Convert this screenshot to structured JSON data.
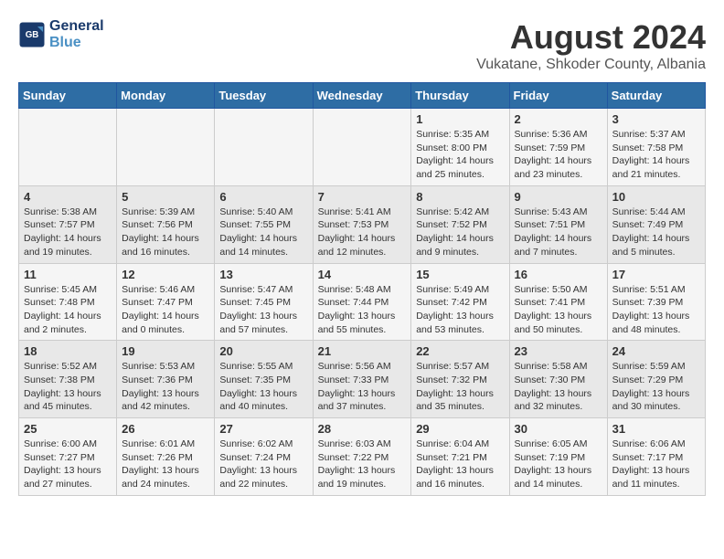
{
  "header": {
    "logo_line1": "General",
    "logo_line2": "Blue",
    "month_year": "August 2024",
    "location": "Vukatane, Shkoder County, Albania"
  },
  "weekdays": [
    "Sunday",
    "Monday",
    "Tuesday",
    "Wednesday",
    "Thursday",
    "Friday",
    "Saturday"
  ],
  "weeks": [
    [
      {
        "day": "",
        "info": ""
      },
      {
        "day": "",
        "info": ""
      },
      {
        "day": "",
        "info": ""
      },
      {
        "day": "",
        "info": ""
      },
      {
        "day": "1",
        "info": "Sunrise: 5:35 AM\nSunset: 8:00 PM\nDaylight: 14 hours\nand 25 minutes."
      },
      {
        "day": "2",
        "info": "Sunrise: 5:36 AM\nSunset: 7:59 PM\nDaylight: 14 hours\nand 23 minutes."
      },
      {
        "day": "3",
        "info": "Sunrise: 5:37 AM\nSunset: 7:58 PM\nDaylight: 14 hours\nand 21 minutes."
      }
    ],
    [
      {
        "day": "4",
        "info": "Sunrise: 5:38 AM\nSunset: 7:57 PM\nDaylight: 14 hours\nand 19 minutes."
      },
      {
        "day": "5",
        "info": "Sunrise: 5:39 AM\nSunset: 7:56 PM\nDaylight: 14 hours\nand 16 minutes."
      },
      {
        "day": "6",
        "info": "Sunrise: 5:40 AM\nSunset: 7:55 PM\nDaylight: 14 hours\nand 14 minutes."
      },
      {
        "day": "7",
        "info": "Sunrise: 5:41 AM\nSunset: 7:53 PM\nDaylight: 14 hours\nand 12 minutes."
      },
      {
        "day": "8",
        "info": "Sunrise: 5:42 AM\nSunset: 7:52 PM\nDaylight: 14 hours\nand 9 minutes."
      },
      {
        "day": "9",
        "info": "Sunrise: 5:43 AM\nSunset: 7:51 PM\nDaylight: 14 hours\nand 7 minutes."
      },
      {
        "day": "10",
        "info": "Sunrise: 5:44 AM\nSunset: 7:49 PM\nDaylight: 14 hours\nand 5 minutes."
      }
    ],
    [
      {
        "day": "11",
        "info": "Sunrise: 5:45 AM\nSunset: 7:48 PM\nDaylight: 14 hours\nand 2 minutes."
      },
      {
        "day": "12",
        "info": "Sunrise: 5:46 AM\nSunset: 7:47 PM\nDaylight: 14 hours\nand 0 minutes."
      },
      {
        "day": "13",
        "info": "Sunrise: 5:47 AM\nSunset: 7:45 PM\nDaylight: 13 hours\nand 57 minutes."
      },
      {
        "day": "14",
        "info": "Sunrise: 5:48 AM\nSunset: 7:44 PM\nDaylight: 13 hours\nand 55 minutes."
      },
      {
        "day": "15",
        "info": "Sunrise: 5:49 AM\nSunset: 7:42 PM\nDaylight: 13 hours\nand 53 minutes."
      },
      {
        "day": "16",
        "info": "Sunrise: 5:50 AM\nSunset: 7:41 PM\nDaylight: 13 hours\nand 50 minutes."
      },
      {
        "day": "17",
        "info": "Sunrise: 5:51 AM\nSunset: 7:39 PM\nDaylight: 13 hours\nand 48 minutes."
      }
    ],
    [
      {
        "day": "18",
        "info": "Sunrise: 5:52 AM\nSunset: 7:38 PM\nDaylight: 13 hours\nand 45 minutes."
      },
      {
        "day": "19",
        "info": "Sunrise: 5:53 AM\nSunset: 7:36 PM\nDaylight: 13 hours\nand 42 minutes."
      },
      {
        "day": "20",
        "info": "Sunrise: 5:55 AM\nSunset: 7:35 PM\nDaylight: 13 hours\nand 40 minutes."
      },
      {
        "day": "21",
        "info": "Sunrise: 5:56 AM\nSunset: 7:33 PM\nDaylight: 13 hours\nand 37 minutes."
      },
      {
        "day": "22",
        "info": "Sunrise: 5:57 AM\nSunset: 7:32 PM\nDaylight: 13 hours\nand 35 minutes."
      },
      {
        "day": "23",
        "info": "Sunrise: 5:58 AM\nSunset: 7:30 PM\nDaylight: 13 hours\nand 32 minutes."
      },
      {
        "day": "24",
        "info": "Sunrise: 5:59 AM\nSunset: 7:29 PM\nDaylight: 13 hours\nand 30 minutes."
      }
    ],
    [
      {
        "day": "25",
        "info": "Sunrise: 6:00 AM\nSunset: 7:27 PM\nDaylight: 13 hours\nand 27 minutes."
      },
      {
        "day": "26",
        "info": "Sunrise: 6:01 AM\nSunset: 7:26 PM\nDaylight: 13 hours\nand 24 minutes."
      },
      {
        "day": "27",
        "info": "Sunrise: 6:02 AM\nSunset: 7:24 PM\nDaylight: 13 hours\nand 22 minutes."
      },
      {
        "day": "28",
        "info": "Sunrise: 6:03 AM\nSunset: 7:22 PM\nDaylight: 13 hours\nand 19 minutes."
      },
      {
        "day": "29",
        "info": "Sunrise: 6:04 AM\nSunset: 7:21 PM\nDaylight: 13 hours\nand 16 minutes."
      },
      {
        "day": "30",
        "info": "Sunrise: 6:05 AM\nSunset: 7:19 PM\nDaylight: 13 hours\nand 14 minutes."
      },
      {
        "day": "31",
        "info": "Sunrise: 6:06 AM\nSunset: 7:17 PM\nDaylight: 13 hours\nand 11 minutes."
      }
    ]
  ]
}
